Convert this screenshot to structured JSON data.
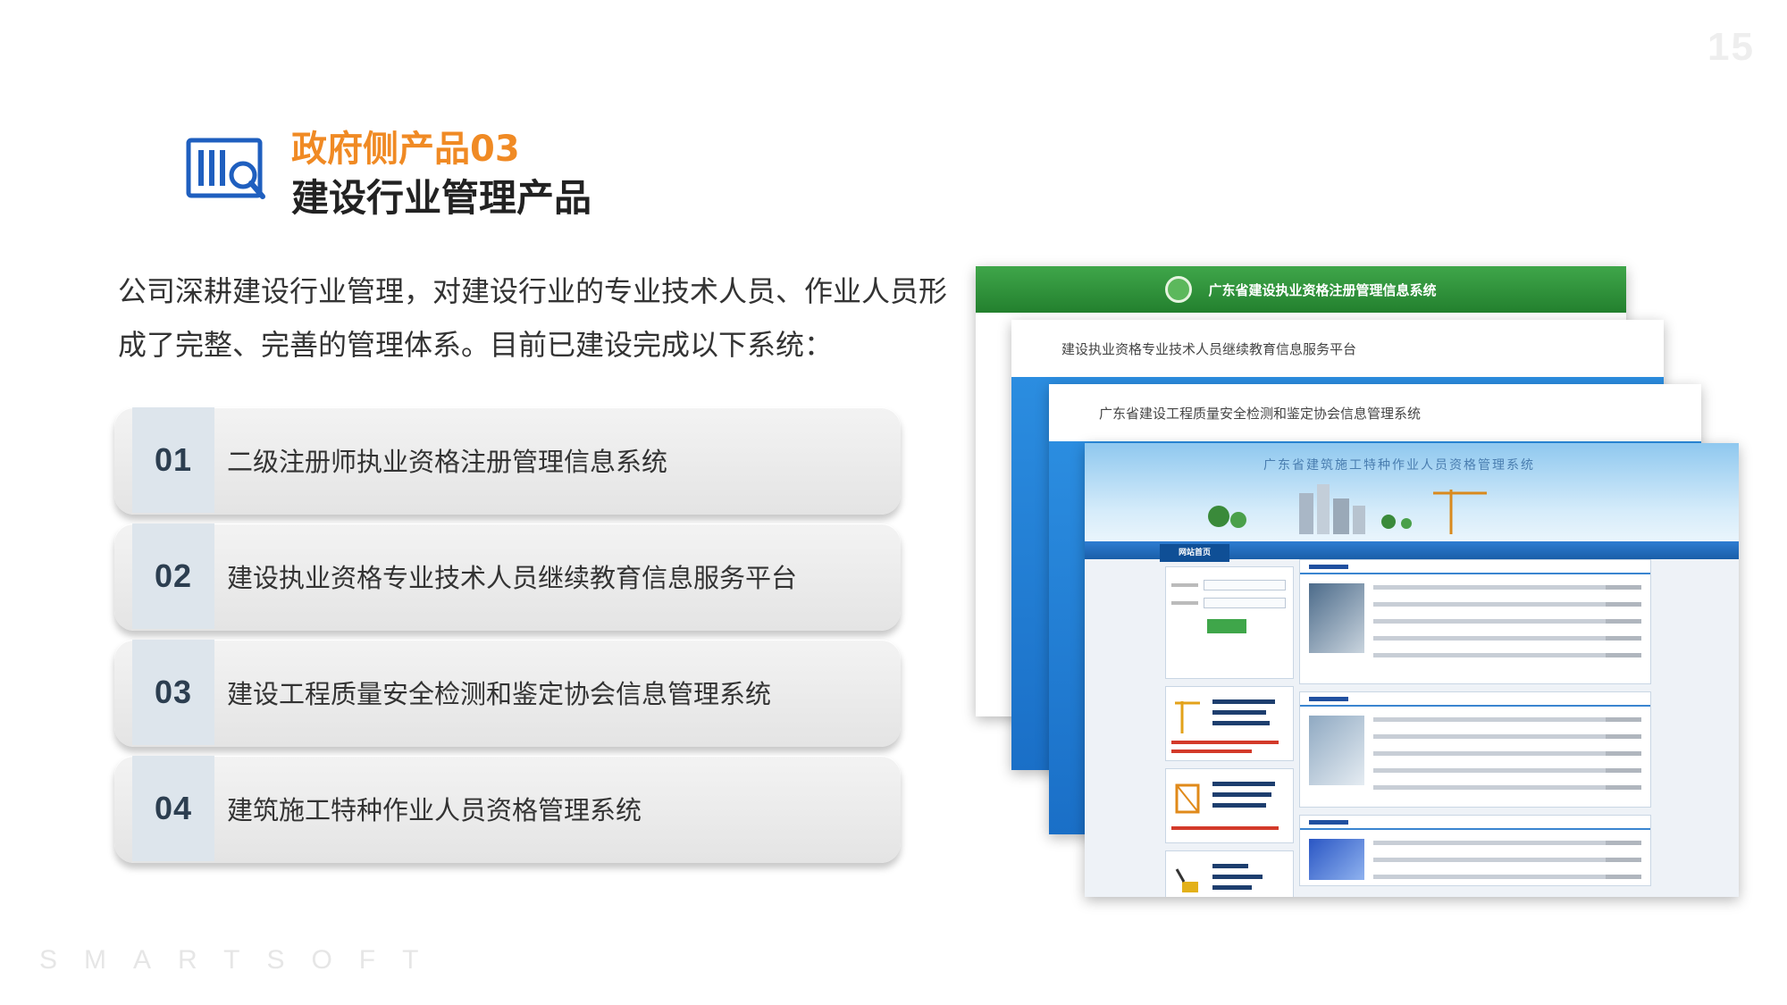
{
  "page_number": "15",
  "heading": {
    "icon": "barcode-search-icon",
    "subtitle": "政府侧产品03",
    "title": "建设行业管理产品"
  },
  "intro": "公司深耕建设行业管理，对建设行业的专业技术人员、作业人员形成了完整、完善的管理体系。目前已建设完成以下系统：",
  "systems": [
    {
      "num": "01",
      "label": "二级注册师执业资格注册管理信息系统"
    },
    {
      "num": "02",
      "label": "建设执业资格专业技术人员继续教育信息服务平台"
    },
    {
      "num": "03",
      "label": "建设工程质量安全检测和鉴定协会信息管理系统"
    },
    {
      "num": "04",
      "label": "建筑施工特种作业人员资格管理系统"
    }
  ],
  "screenshots": {
    "s1_title": "广东省建设执业资格注册管理信息系统",
    "s2_title": "建设执业资格专业技术人员继续教育信息服务平台",
    "s3_title": "广东省建设工程质量安全检测和鉴定协会信息管理系统",
    "s4_title": "广东省建筑施工特种作业人员资格管理系统",
    "s4_nav": "网站首页"
  },
  "footer_brand": "SMARTSOFT",
  "colors": {
    "accent_orange": "#f08a24",
    "icon_blue": "#1f5fbf",
    "number_bg": "#dde5ec"
  }
}
